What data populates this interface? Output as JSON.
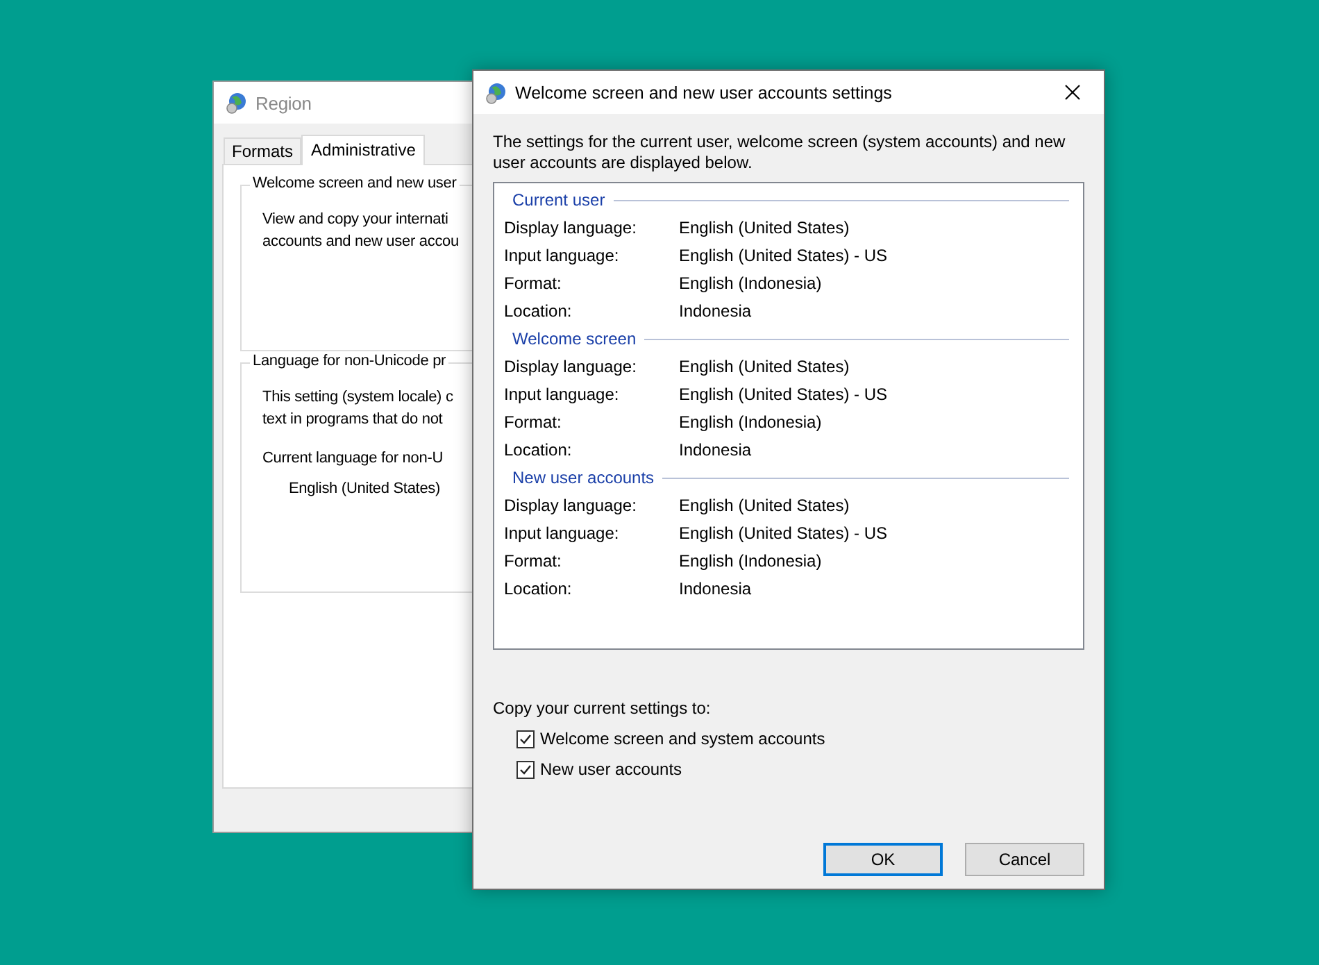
{
  "background_window": {
    "title": "Region",
    "tabs": [
      {
        "label": "Formats",
        "selected": false
      },
      {
        "label": "Administrative",
        "selected": true
      }
    ],
    "groups": [
      {
        "title": "Welcome screen and new user",
        "lines": [
          "View and copy your internati",
          "accounts and new user accou"
        ]
      },
      {
        "title": "Language for non-Unicode pr",
        "lines": [
          "This setting (system locale) c",
          "text in programs that do not"
        ],
        "label": "Current language for non-U",
        "value": "English (United States)"
      }
    ]
  },
  "dialog": {
    "title": "Welcome screen and new user accounts settings",
    "intro": "The settings for the current user, welcome screen (system accounts) and new user accounts are displayed below.",
    "sections": [
      {
        "title": "Current user",
        "rows": [
          {
            "label": "Display language:",
            "value": "English (United States)"
          },
          {
            "label": "Input language:",
            "value": "English (United States) - US"
          },
          {
            "label": "Format:",
            "value": "English (Indonesia)"
          },
          {
            "label": "Location:",
            "value": "Indonesia"
          }
        ]
      },
      {
        "title": "Welcome screen",
        "rows": [
          {
            "label": "Display language:",
            "value": "English (United States)"
          },
          {
            "label": "Input language:",
            "value": "English (United States) - US"
          },
          {
            "label": "Format:",
            "value": "English (Indonesia)"
          },
          {
            "label": "Location:",
            "value": "Indonesia"
          }
        ]
      },
      {
        "title": "New user accounts",
        "rows": [
          {
            "label": "Display language:",
            "value": "English (United States)"
          },
          {
            "label": "Input language:",
            "value": "English (United States) - US"
          },
          {
            "label": "Format:",
            "value": "English (Indonesia)"
          },
          {
            "label": "Location:",
            "value": "Indonesia"
          }
        ]
      }
    ],
    "copy_label": "Copy your current settings to:",
    "checkboxes": [
      {
        "label": "Welcome screen and system accounts",
        "checked": true
      },
      {
        "label": "New user accounts",
        "checked": true
      }
    ],
    "buttons": [
      {
        "label": "OK",
        "default": true
      },
      {
        "label": "Cancel",
        "default": false
      }
    ]
  }
}
